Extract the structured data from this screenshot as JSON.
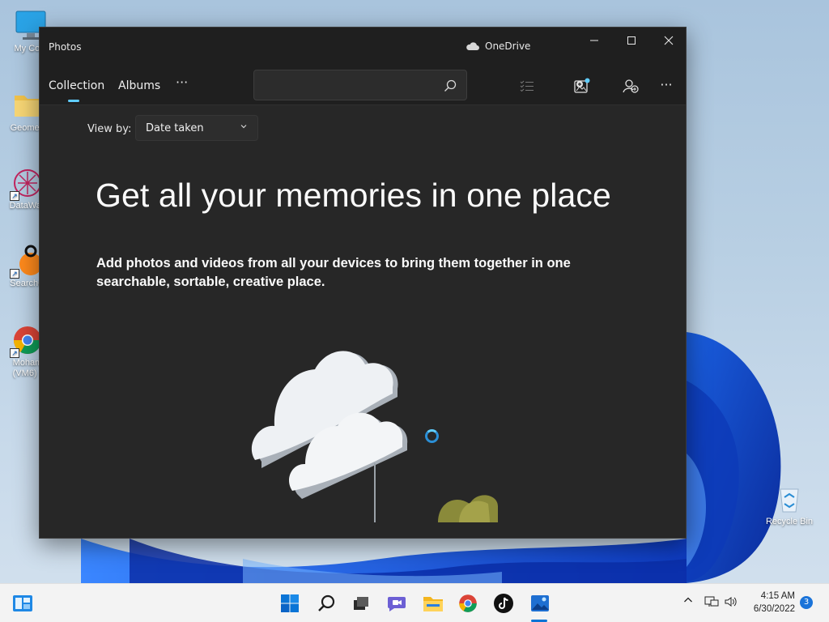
{
  "desktop": {
    "icons": [
      {
        "label": "My Com",
        "icon": "monitor-icon"
      },
      {
        "label": "Geometr",
        "icon": "folder-icon"
      },
      {
        "label": "DataWac",
        "icon": "datawac-icon"
      },
      {
        "label": "SearchG",
        "icon": "searchg-icon"
      },
      {
        "label": "Moham",
        "label2": "(VM6) -",
        "icon": "chrome-icon"
      },
      {
        "label": "Recycle Bin",
        "icon": "recycle-bin-icon"
      }
    ]
  },
  "window": {
    "title": "Photos",
    "onedrive_label": "OneDrive",
    "controls": {
      "minimize": "—",
      "maximize": "☐",
      "close": "✕"
    }
  },
  "nav": {
    "tabs": [
      {
        "label": "Collection",
        "active": true
      },
      {
        "label": "Albums",
        "active": false
      }
    ],
    "more": "···",
    "search": {
      "placeholder": "",
      "value": ""
    },
    "toolbar_icons": [
      "select-list-icon",
      "import-icon",
      "people-icon",
      "overflow-icon"
    ],
    "overflow": "···"
  },
  "content": {
    "viewby_label": "View by:",
    "viewby_value": "Date taken",
    "headline": "Get all your memories in one place",
    "subtext": "Add photos and videos from all your devices to bring them together in one searchable, sortable, creative place."
  },
  "taskbar": {
    "apps": [
      "widgets-icon",
      "start-icon",
      "search-icon",
      "task-view-icon",
      "chat-icon",
      "file-explorer-icon",
      "chrome-icon",
      "tiktok-icon",
      "photos-icon"
    ],
    "time": "4:15 AM",
    "date": "6/30/2022",
    "notification_count": "3"
  },
  "colors": {
    "accent": "#60cdff",
    "window_bg": "#272727",
    "titlebar_bg": "#1f1f1f",
    "taskbar_bg": "#f3f3f3"
  }
}
